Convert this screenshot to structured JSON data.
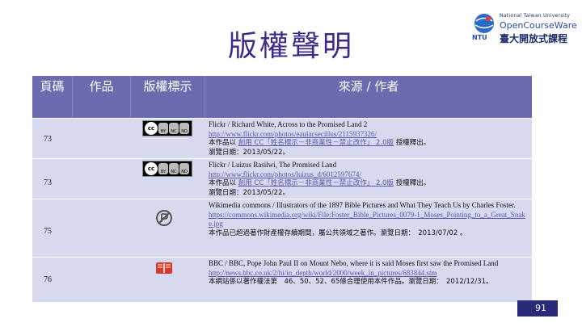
{
  "title": "版權聲明",
  "logo": {
    "line1": "National Taiwan University",
    "line2": "OpenCourseWare",
    "line3": "臺大開放式課程",
    "ntu": "NTU"
  },
  "table": {
    "headers": [
      "頁碼",
      "作品",
      "版權標示",
      "來源 / 作者"
    ],
    "rows": [
      {
        "page": "73",
        "license_icon": "cc-by-nc-nd-icon",
        "source": "Flickr / Richard White, Across to the Promised Land 2",
        "link": "http://www.flickr.com/photos/eaulacsecillus/2115937326/",
        "license_prefix": "本作品以",
        "license_link": "創用 CC「姓名標示－非商業性－禁止改作」 2.0版",
        "license_suffix": "授權釋出。",
        "date": "瀏覽日期：2013/05/22。"
      },
      {
        "page": "73",
        "license_icon": "cc-by-nc-nd-icon",
        "source": "Flickr / Luizus Rasilwi, The Promised Land",
        "link": "http://www.flickr.com/photos/luizus_d/6012597674/",
        "license_prefix": "本作品以",
        "license_link": "創用 CC「姓名標示－非商業性－禁止改作」 2.0版",
        "license_suffix": "授權釋出。",
        "date": "瀏覽日期：2013/05/22。"
      },
      {
        "page": "75",
        "license_icon": "public-domain-icon",
        "source": "Wikimedia commons / Illustrators of the 1897 Bible Pictures and What They Teach Us by Charles Foster.",
        "link": "https://commons.wikimedia.org/wiki/File:Foster_Bible_Pictures_0079-1_Moses_Pointing_to_a_Great_Snake.jpg",
        "note": "本作品已超過著作財產權存續期間，屬公共領域之著作。瀏覽日期：　2013/07/02 。"
      },
      {
        "page": "76",
        "license_icon": "fair-use-icon",
        "source": "BBC / BBC, Pope John Paul II on Mount Nebo, where it is said Moses first saw the Promised Land",
        "link": "http://news.bbc.co.uk/2/hi/in_depth/world/2000/week_in_pictures/683844.stm",
        "note": "本網站係以著作權法第　46、50、52、65條合理使用本件作品。瀏覽日期：　2012/12/31。"
      }
    ]
  },
  "page_number": "91",
  "colors": {
    "title": "#3d2a8a",
    "header_bg": "#6b6bb0",
    "body_bg": "#d7d9ee"
  }
}
